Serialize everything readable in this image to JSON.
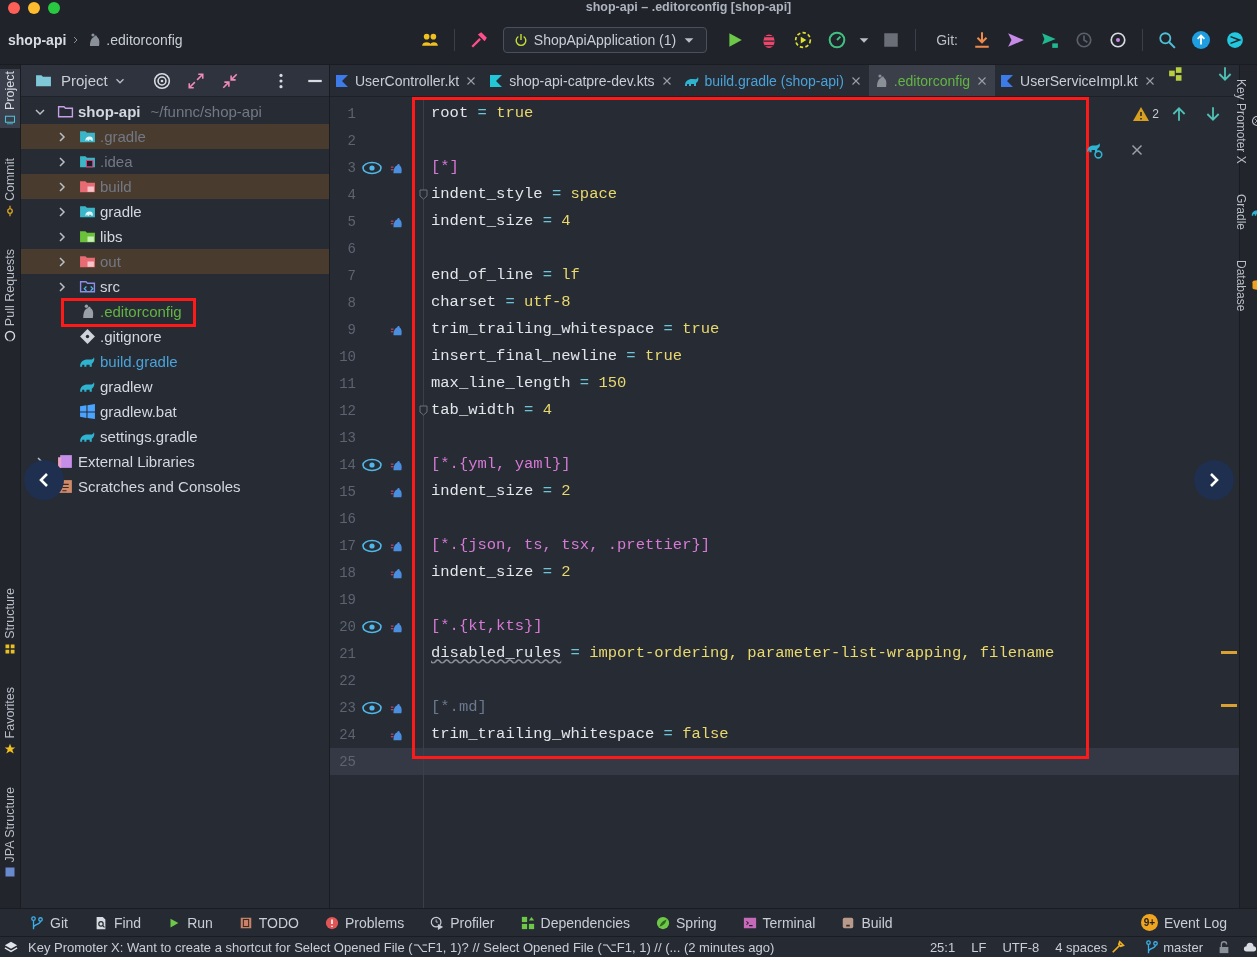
{
  "window": {
    "title": "shop-api – .editorconfig [shop-api]"
  },
  "navbar": {
    "breadcrumb": [
      "shop-api",
      ".editorconfig"
    ],
    "run_config": "ShopApiApplication (1)",
    "git_label": "Git:"
  },
  "left_strip": {
    "top": [
      {
        "label": "Project",
        "kind": "monitor",
        "selected": true
      },
      {
        "label": "Commit",
        "kind": "commit",
        "selected": false
      },
      {
        "label": "Pull Requests",
        "kind": "github",
        "selected": false
      }
    ],
    "bottom": [
      {
        "label": "Structure",
        "kind": "structure",
        "selected": false
      },
      {
        "label": "Favorites",
        "kind": "star",
        "selected": false
      },
      {
        "label": "JPA Structure",
        "kind": "jpa",
        "selected": false
      }
    ]
  },
  "project_panel": {
    "title": "Project",
    "tree": [
      {
        "name": "shop-api",
        "path": "~/funnc/shop-api",
        "kind": "module",
        "color": "#d3d7de",
        "excluded": false,
        "expanded": true,
        "annotated": false,
        "children": [
          {
            "name": ".gradle",
            "kind": "folder-gradle",
            "color": "#727985",
            "excluded": true,
            "expanded": false,
            "annotated": false
          },
          {
            "name": ".idea",
            "kind": "folder-idea",
            "color": "#727985",
            "excluded": false,
            "expanded": false,
            "annotated": false
          },
          {
            "name": "build",
            "kind": "folder-red",
            "color": "#727985",
            "excluded": true,
            "expanded": false,
            "annotated": false
          },
          {
            "name": "gradle",
            "kind": "folder-gradle",
            "color": "#d3d7de",
            "excluded": false,
            "expanded": false,
            "annotated": false
          },
          {
            "name": "libs",
            "kind": "folder-libs",
            "color": "#d3d7de",
            "excluded": false,
            "expanded": false,
            "annotated": false
          },
          {
            "name": "out",
            "kind": "folder-red",
            "color": "#727985",
            "excluded": true,
            "expanded": false,
            "annotated": false
          },
          {
            "name": "src",
            "kind": "folder-src",
            "color": "#d3d7de",
            "excluded": false,
            "expanded": false,
            "annotated": false
          },
          {
            "name": ".editorconfig",
            "kind": "editorconfig",
            "color": "#62b543",
            "excluded": false,
            "annotated": true
          },
          {
            "name": ".gitignore",
            "kind": "git",
            "color": "#d3d7de",
            "excluded": false,
            "annotated": false
          },
          {
            "name": "build.gradle",
            "kind": "gradle",
            "color": "#4aa3d8",
            "excluded": false,
            "annotated": false
          },
          {
            "name": "gradlew",
            "kind": "gradle",
            "color": "#d3d7de",
            "excluded": false,
            "annotated": false
          },
          {
            "name": "gradlew.bat",
            "kind": "windows",
            "color": "#d3d7de",
            "excluded": false,
            "annotated": false
          },
          {
            "name": "settings.gradle",
            "kind": "gradle",
            "color": "#d3d7de",
            "excluded": false,
            "annotated": false
          }
        ]
      },
      {
        "name": "External Libraries",
        "kind": "library",
        "color": "#d3d7de",
        "excluded": false,
        "expanded": false,
        "annotated": false
      },
      {
        "name": "Scratches and Consoles",
        "kind": "scratches",
        "color": "#d3d7de",
        "excluded": false,
        "annotated": false
      }
    ]
  },
  "editor": {
    "annotated": true,
    "warnings": "2",
    "tabs": [
      {
        "label": "UserController.kt",
        "kind": "kotlin",
        "color": "#c9ced6",
        "selected": false
      },
      {
        "label": "shop-api-catpre-dev.kts",
        "kind": "kotlin-script",
        "color": "#c9ced6",
        "selected": false
      },
      {
        "label": "build.gradle (shop-api)",
        "kind": "gradle",
        "color": "#4aa3d8",
        "selected": false
      },
      {
        "label": ".editorconfig",
        "kind": "editorconfig",
        "color": "#62b543",
        "selected": true
      },
      {
        "label": "UserServiceImpl.kt",
        "kind": "kotlin",
        "color": "#c9ced6",
        "selected": false
      }
    ],
    "lines": [
      {
        "number": "1",
        "eye": false,
        "marker": false,
        "fold": false,
        "current": false,
        "tokens": [
          {
            "kind": "key",
            "text": "root"
          },
          {
            "kind": "op",
            "text": " = "
          },
          {
            "kind": "value",
            "text": "true"
          }
        ]
      },
      {
        "number": "2",
        "eye": false,
        "marker": false,
        "fold": false,
        "current": false
      },
      {
        "number": "3",
        "eye": true,
        "marker": true,
        "fold": false,
        "current": false,
        "tokens": [
          {
            "kind": "section",
            "text": "[*]"
          }
        ]
      },
      {
        "number": "4",
        "eye": false,
        "marker": false,
        "fold": true,
        "current": false,
        "tokens": [
          {
            "kind": "key",
            "text": "indent_style"
          },
          {
            "kind": "op",
            "text": " = "
          },
          {
            "kind": "value",
            "text": "space"
          }
        ]
      },
      {
        "number": "5",
        "eye": false,
        "marker": true,
        "fold": false,
        "current": false,
        "tokens": [
          {
            "kind": "key",
            "text": "indent_size"
          },
          {
            "kind": "op",
            "text": " = "
          },
          {
            "kind": "value",
            "text": "4"
          }
        ]
      },
      {
        "number": "6",
        "eye": false,
        "marker": false,
        "fold": false,
        "current": false
      },
      {
        "number": "7",
        "eye": false,
        "marker": false,
        "fold": false,
        "current": false,
        "tokens": [
          {
            "kind": "key",
            "text": "end_of_line"
          },
          {
            "kind": "op",
            "text": " = "
          },
          {
            "kind": "value",
            "text": "lf"
          }
        ]
      },
      {
        "number": "8",
        "eye": false,
        "marker": false,
        "fold": false,
        "current": false,
        "tokens": [
          {
            "kind": "key",
            "text": "charset"
          },
          {
            "kind": "op",
            "text": " = "
          },
          {
            "kind": "value",
            "text": "utf-8"
          }
        ]
      },
      {
        "number": "9",
        "eye": false,
        "marker": true,
        "fold": false,
        "current": false,
        "tokens": [
          {
            "kind": "key",
            "text": "trim_trailing_whitespace"
          },
          {
            "kind": "op",
            "text": " = "
          },
          {
            "kind": "value",
            "text": "true"
          }
        ]
      },
      {
        "number": "10",
        "eye": false,
        "marker": false,
        "fold": false,
        "current": false,
        "tokens": [
          {
            "kind": "key",
            "text": "insert_final_newline"
          },
          {
            "kind": "op",
            "text": " = "
          },
          {
            "kind": "value",
            "text": "true"
          }
        ]
      },
      {
        "number": "11",
        "eye": false,
        "marker": false,
        "fold": false,
        "current": false,
        "tokens": [
          {
            "kind": "key",
            "text": "max_line_length"
          },
          {
            "kind": "op",
            "text": " = "
          },
          {
            "kind": "value",
            "text": "150"
          }
        ]
      },
      {
        "number": "12",
        "eye": false,
        "marker": false,
        "fold": true,
        "current": false,
        "tokens": [
          {
            "kind": "key",
            "text": "tab_width"
          },
          {
            "kind": "op",
            "text": " = "
          },
          {
            "kind": "value",
            "text": "4"
          }
        ]
      },
      {
        "number": "13",
        "eye": false,
        "marker": false,
        "fold": false,
        "current": false
      },
      {
        "number": "14",
        "eye": true,
        "marker": true,
        "fold": false,
        "current": false,
        "tokens": [
          {
            "kind": "section",
            "text": "[*.{yml, yaml}]"
          }
        ]
      },
      {
        "number": "15",
        "eye": false,
        "marker": true,
        "fold": false,
        "current": false,
        "tokens": [
          {
            "kind": "key",
            "text": "indent_size"
          },
          {
            "kind": "op",
            "text": " = "
          },
          {
            "kind": "value",
            "text": "2"
          }
        ]
      },
      {
        "number": "16",
        "eye": false,
        "marker": false,
        "fold": false,
        "current": false
      },
      {
        "number": "17",
        "eye": true,
        "marker": true,
        "fold": false,
        "current": false,
        "tokens": [
          {
            "kind": "section",
            "text": "[*.{json, ts, tsx, .prettier}]"
          }
        ]
      },
      {
        "number": "18",
        "eye": false,
        "marker": true,
        "fold": false,
        "current": false,
        "tokens": [
          {
            "kind": "key",
            "text": "indent_size"
          },
          {
            "kind": "op",
            "text": " = "
          },
          {
            "kind": "value",
            "text": "2"
          }
        ]
      },
      {
        "number": "19",
        "eye": false,
        "marker": false,
        "fold": false,
        "current": false
      },
      {
        "number": "20",
        "eye": true,
        "marker": true,
        "fold": false,
        "current": false,
        "tokens": [
          {
            "kind": "section",
            "text": "[*.{kt,kts}]"
          }
        ]
      },
      {
        "number": "21",
        "eye": false,
        "marker": false,
        "fold": false,
        "current": false,
        "tokens": [
          {
            "kind": "key-warning",
            "text": "disabled_rules"
          },
          {
            "kind": "op",
            "text": " = "
          },
          {
            "kind": "value",
            "text": "import-ordering, parameter-list-wrapping, filename"
          }
        ]
      },
      {
        "number": "22",
        "eye": false,
        "marker": false,
        "fold": false,
        "current": false
      },
      {
        "number": "23",
        "eye": true,
        "marker": true,
        "fold": false,
        "current": false,
        "tokens": [
          {
            "kind": "section-muted",
            "text": "[*.md]"
          }
        ]
      },
      {
        "number": "24",
        "eye": false,
        "marker": true,
        "fold": false,
        "current": false,
        "tokens": [
          {
            "kind": "key",
            "text": "trim_trailing_whitespace"
          },
          {
            "kind": "op",
            "text": " = "
          },
          {
            "kind": "value",
            "text": "false"
          }
        ]
      },
      {
        "number": "25",
        "eye": false,
        "marker": false,
        "fold": false,
        "current": true
      }
    ]
  },
  "right_strip": [
    {
      "label": "Key Promoter X",
      "kind": "key"
    },
    {
      "label": "Gradle",
      "kind": "gradle"
    },
    {
      "label": "Database",
      "kind": "database"
    }
  ],
  "tool_windows": [
    {
      "label": "Git",
      "kind": "branch"
    },
    {
      "label": "Find",
      "kind": "find"
    },
    {
      "label": "Run",
      "kind": "run"
    },
    {
      "label": "TODO",
      "kind": "todo"
    },
    {
      "label": "Problems",
      "kind": "problems"
    },
    {
      "label": "Profiler",
      "kind": "profiler"
    },
    {
      "label": "Dependencies",
      "kind": "dependencies"
    },
    {
      "label": "Spring",
      "kind": "spring"
    },
    {
      "label": "Terminal",
      "kind": "terminal"
    },
    {
      "label": "Build",
      "kind": "build"
    }
  ],
  "event_log": {
    "label": "Event Log",
    "badge": "9+"
  },
  "status_bar": {
    "message": "Key Promoter X: Want to create a shortcut for Select Opened File (⌥F1, 1)? // Select Opened File (⌥F1, 1) // (... (2 minutes ago)",
    "position": "25:1",
    "line_separator": "LF",
    "encoding": "UTF-8",
    "indent": "4 spaces",
    "branch": "master"
  }
}
